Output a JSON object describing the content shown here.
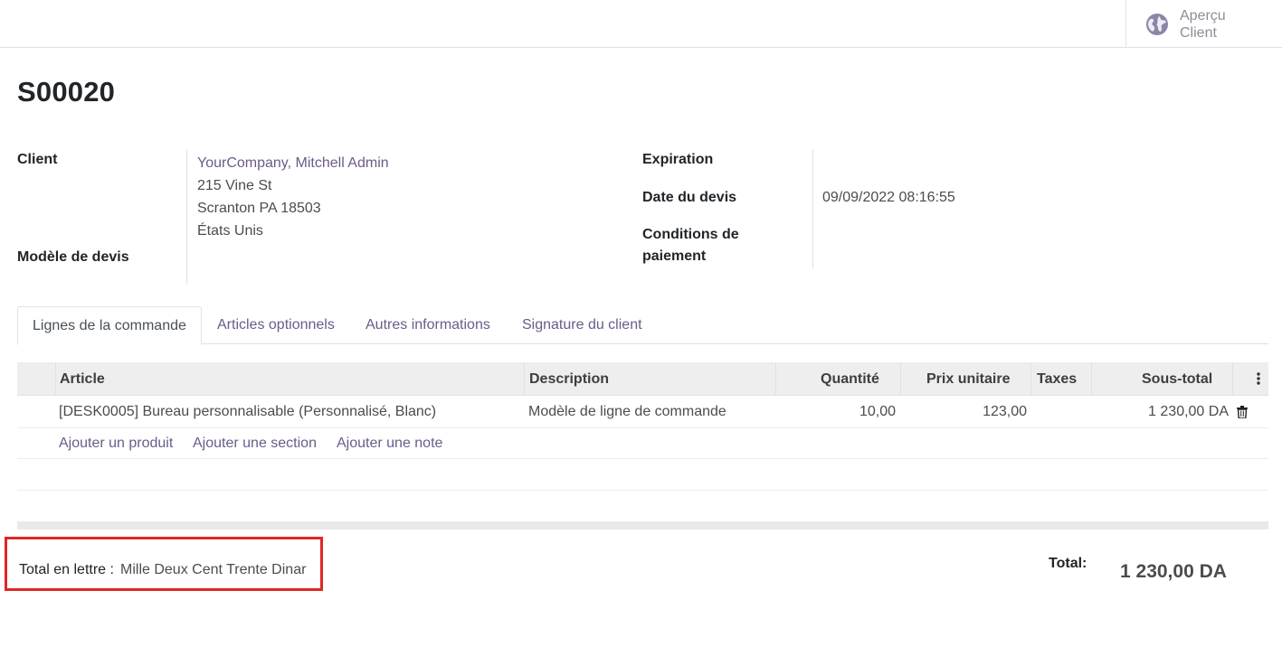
{
  "header": {
    "preview_label": "Aperçu Client",
    "preview_icon": "globe-icon"
  },
  "record": {
    "title": "S00020"
  },
  "fields": {
    "client_label": "Client",
    "client_name": "YourCompany, Mitchell Admin",
    "client_address": [
      "215 Vine St",
      "Scranton PA 18503",
      "États Unis"
    ],
    "template_label": "Modèle de devis",
    "expiration_label": "Expiration",
    "quote_date_label": "Date du devis",
    "quote_date_value": "09/09/2022 08:16:55",
    "payment_terms_label_1": "Conditions de",
    "payment_terms_label_2": "paiement"
  },
  "tabs": [
    {
      "label": "Lignes de la commande",
      "active": true
    },
    {
      "label": "Articles optionnels",
      "active": false
    },
    {
      "label": "Autres informations",
      "active": false
    },
    {
      "label": "Signature du client",
      "active": false
    }
  ],
  "table": {
    "columns": [
      "Article",
      "Description",
      "Quantité",
      "Prix unitaire",
      "Taxes",
      "Sous-total"
    ],
    "rows": [
      {
        "article": "[DESK0005] Bureau personnalisable (Personnalisé, Blanc)",
        "description": "Modèle de ligne de commande",
        "quantity": "10,00",
        "unit_price": "123,00",
        "taxes": "",
        "subtotal": "1 230,00 DA"
      }
    ],
    "actions": {
      "add_product": "Ajouter un produit",
      "add_section": "Ajouter une section",
      "add_note": "Ajouter une note"
    }
  },
  "totals": {
    "in_words_label": "Total en lettre :",
    "in_words_value": "Mille Deux Cent Trente Dinar",
    "total_label": "Total:",
    "total_value": "1 230,00 DA"
  },
  "colors": {
    "link": "#6b5b8a",
    "highlight_border": "#e02626"
  }
}
